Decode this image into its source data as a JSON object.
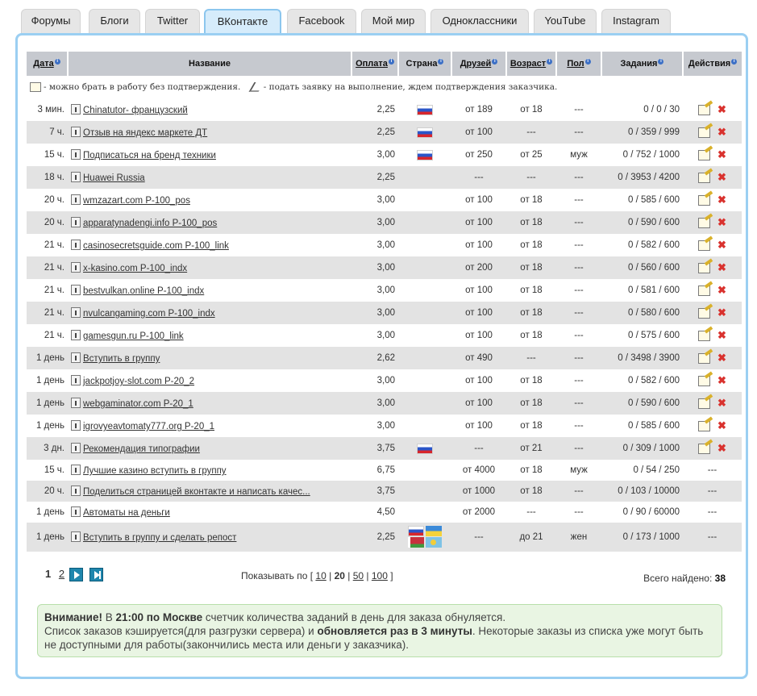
{
  "tabs": [
    {
      "label": "Форумы"
    },
    {
      "label": "Блоги"
    },
    {
      "label": "Twitter"
    },
    {
      "label": "ВКонтакте",
      "active": true
    },
    {
      "label": "Facebook"
    },
    {
      "label": "Мой мир"
    },
    {
      "label": "Одноклассники"
    },
    {
      "label": "YouTube"
    },
    {
      "label": "Instagram"
    }
  ],
  "table": {
    "headers": {
      "date": "Дата",
      "name": "Название",
      "payment": "Оплата",
      "country": "Страна",
      "friends": "Друзей",
      "age": "Возраст",
      "sex": "Пол",
      "tasks": "Задания",
      "actions": "Действия"
    },
    "legend": {
      "text1": "- можно брать в работу без подтверждения.",
      "text2": "- подать заявку на выполнение, ждем подтверждения заказчика."
    },
    "rows": [
      {
        "date": "3 мин.",
        "name": "Chinatutor- французский",
        "payment": "2,25",
        "flags": [
          "ru"
        ],
        "friends": "от 189",
        "age": "от 18",
        "sex": "---",
        "tasks": "0 / 0 / 30",
        "actions": true
      },
      {
        "date": "7 ч.",
        "name": "Отзыв на яндекс маркете ДТ",
        "payment": "2,25",
        "flags": [
          "ru"
        ],
        "friends": "от 100",
        "age": "---",
        "sex": "---",
        "tasks": "0 / 359 / 999",
        "actions": true
      },
      {
        "date": "15 ч.",
        "name": "Подписаться на бренд техники",
        "payment": "3,00",
        "flags": [
          "ru"
        ],
        "friends": "от 250",
        "age": "от 25",
        "sex": "муж",
        "tasks": "0 / 752 / 1000",
        "actions": true
      },
      {
        "date": "18 ч.",
        "name": "Huawei Russia",
        "payment": "2,25",
        "flags": [],
        "friends": "---",
        "age": "---",
        "sex": "---",
        "tasks": "0 / 3953 / 4200",
        "actions": true
      },
      {
        "date": "20 ч.",
        "name": "wmzazart.com P-100_pos",
        "payment": "3,00",
        "flags": [],
        "friends": "от 100",
        "age": "от 18",
        "sex": "---",
        "tasks": "0 / 585 / 600",
        "actions": true
      },
      {
        "date": "20 ч.",
        "name": "apparatynadengi.info P-100_pos",
        "payment": "3,00",
        "flags": [],
        "friends": "от 100",
        "age": "от 18",
        "sex": "---",
        "tasks": "0 / 590 / 600",
        "actions": true
      },
      {
        "date": "21 ч.",
        "name": "casinosecretsguide.com P-100_link",
        "payment": "3,00",
        "flags": [],
        "friends": "от 100",
        "age": "от 18",
        "sex": "---",
        "tasks": "0 / 582 / 600",
        "actions": true
      },
      {
        "date": "21 ч.",
        "name": "x-kasino.com P-100_indx",
        "payment": "3,00",
        "flags": [],
        "friends": "от 200",
        "age": "от 18",
        "sex": "---",
        "tasks": "0 / 560 / 600",
        "actions": true
      },
      {
        "date": "21 ч.",
        "name": "bestvulkan.online P-100_indx",
        "payment": "3,00",
        "flags": [],
        "friends": "от 100",
        "age": "от 18",
        "sex": "---",
        "tasks": "0 / 581 / 600",
        "actions": true
      },
      {
        "date": "21 ч.",
        "name": "nvulcangaming.com P-100_indx",
        "payment": "3,00",
        "flags": [],
        "friends": "от 100",
        "age": "от 18",
        "sex": "---",
        "tasks": "0 / 580 / 600",
        "actions": true
      },
      {
        "date": "21 ч.",
        "name": "gamesgun.ru P-100_link",
        "payment": "3,00",
        "flags": [],
        "friends": "от 100",
        "age": "от 18",
        "sex": "---",
        "tasks": "0 / 575 / 600",
        "actions": true
      },
      {
        "date": "1 день",
        "name": "Вступить в группу",
        "payment": "2,62",
        "flags": [],
        "friends": "от 490",
        "age": "---",
        "sex": "---",
        "tasks": "0 / 3498 / 3900",
        "actions": true
      },
      {
        "date": "1 день",
        "name": "jackpotjoy-slot.com P-20_2",
        "payment": "3,00",
        "flags": [],
        "friends": "от 100",
        "age": "от 18",
        "sex": "---",
        "tasks": "0 / 582 / 600",
        "actions": true
      },
      {
        "date": "1 день",
        "name": "webgaminator.com P-20_1",
        "payment": "3,00",
        "flags": [],
        "friends": "от 100",
        "age": "от 18",
        "sex": "---",
        "tasks": "0 / 590 / 600",
        "actions": true
      },
      {
        "date": "1 день",
        "name": "igrovyeavtomaty777.org P-20_1",
        "payment": "3,00",
        "flags": [],
        "friends": "от 100",
        "age": "от 18",
        "sex": "---",
        "tasks": "0 / 585 / 600",
        "actions": true
      },
      {
        "date": "3 дн.",
        "name": "Рекомендация типографии",
        "payment": "3,75",
        "flags": [
          "ru"
        ],
        "friends": "---",
        "age": "от 21",
        "sex": "---",
        "tasks": "0 / 309 / 1000",
        "actions": true
      },
      {
        "date": "15 ч.",
        "name": "Лучшие казино вступить в группу",
        "payment": "6,75",
        "flags": [],
        "friends": "от 4000",
        "age": "от 18",
        "sex": "муж",
        "tasks": "0 / 54 / 250",
        "actions": false,
        "actions_text": "---"
      },
      {
        "date": "20 ч.",
        "name": "Поделиться страницей вконтакте и написать качес...",
        "payment": "3,75",
        "flags": [],
        "friends": "от 1000",
        "age": "от 18",
        "sex": "---",
        "tasks": "0 / 103 / 10000",
        "actions": false,
        "actions_text": "---"
      },
      {
        "date": "1 день",
        "name": "Автоматы на деньги",
        "payment": "4,50",
        "flags": [],
        "friends": "от 2000",
        "age": "---",
        "sex": "---",
        "tasks": "0 / 90 / 60000",
        "actions": false,
        "actions_text": "---"
      },
      {
        "date": "1 день",
        "name": "Вступить в группу и сделать репост",
        "payment": "2,25",
        "flags": [
          "ru",
          "ua",
          "by",
          "kz"
        ],
        "friends": "---",
        "age": "до 21",
        "sex": "жен",
        "tasks": "0 / 173 / 1000",
        "actions": false,
        "actions_text": "---"
      }
    ]
  },
  "pagination": {
    "pages": [
      "1",
      "2"
    ],
    "current": "1",
    "per_page_label": "Показывать по",
    "per_page_options": [
      "10",
      "20",
      "50",
      "100"
    ],
    "per_page_current": "20",
    "total_label": "Всего найдено:",
    "total_value": "38"
  },
  "notice": {
    "attention": "Внимание!",
    "part1": " В ",
    "time": "21:00 по Москве",
    "part2": " счетчик количества заданий в день для заказа обнуляется.",
    "line2a": "Список заказов кэшируется(для разгрузки сервера) и ",
    "line2b": "обновляется раз в 3 минуты",
    "line2c": ". Некоторые заказы из списка уже могут быть не доступными для работы(закончились места или деньги у заказчика)."
  }
}
